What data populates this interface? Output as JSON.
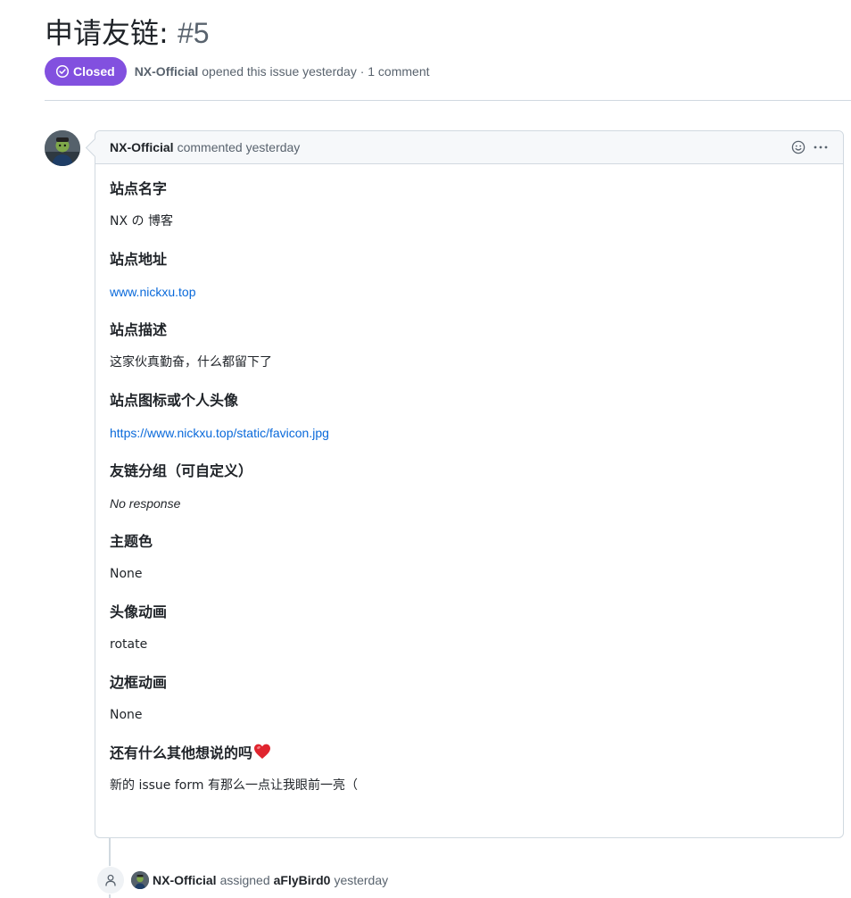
{
  "issue": {
    "title": "申请友链",
    "title_sep": ":",
    "number": "#5",
    "state": "Closed",
    "author": "NX-Official",
    "opened_text": "opened this issue yesterday · 1 comment"
  },
  "comment": {
    "author": "NX-Official",
    "time_text": "commented yesterday",
    "fields": [
      {
        "heading": "站点名字",
        "value": "NX の 博客"
      },
      {
        "heading": "站点地址",
        "value": "www.nickxu.top"
      },
      {
        "heading": "站点描述",
        "value": "这家伙真勤奋，什么都留下了"
      },
      {
        "heading": "站点图标或个人头像",
        "value": "https://www.nickxu.top/static/favicon.jpg"
      },
      {
        "heading": "友链分组（可自定义）",
        "value": "No response"
      },
      {
        "heading": "主题色",
        "value": "None"
      },
      {
        "heading": "头像动画",
        "value": "rotate"
      },
      {
        "heading": "边框动画",
        "value": "None"
      },
      {
        "heading": "还有什么其他想说的吗",
        "value": "新的 issue form 有那么一点让我眼前一亮（"
      }
    ]
  },
  "timeline_event": {
    "actor": "NX-Official",
    "action": "assigned",
    "assignee": "aFlyBird0",
    "time": "yesterday"
  },
  "icons": {
    "state": "check-circle-icon",
    "reaction": "smiley-icon",
    "menu": "kebab-horizontal-icon",
    "event": "person-icon",
    "emoji": "red-heart-icon"
  },
  "colors": {
    "closed_badge": "#8250df",
    "link": "#0969da",
    "muted_text": "#59636e",
    "border": "#d1d9e0"
  }
}
